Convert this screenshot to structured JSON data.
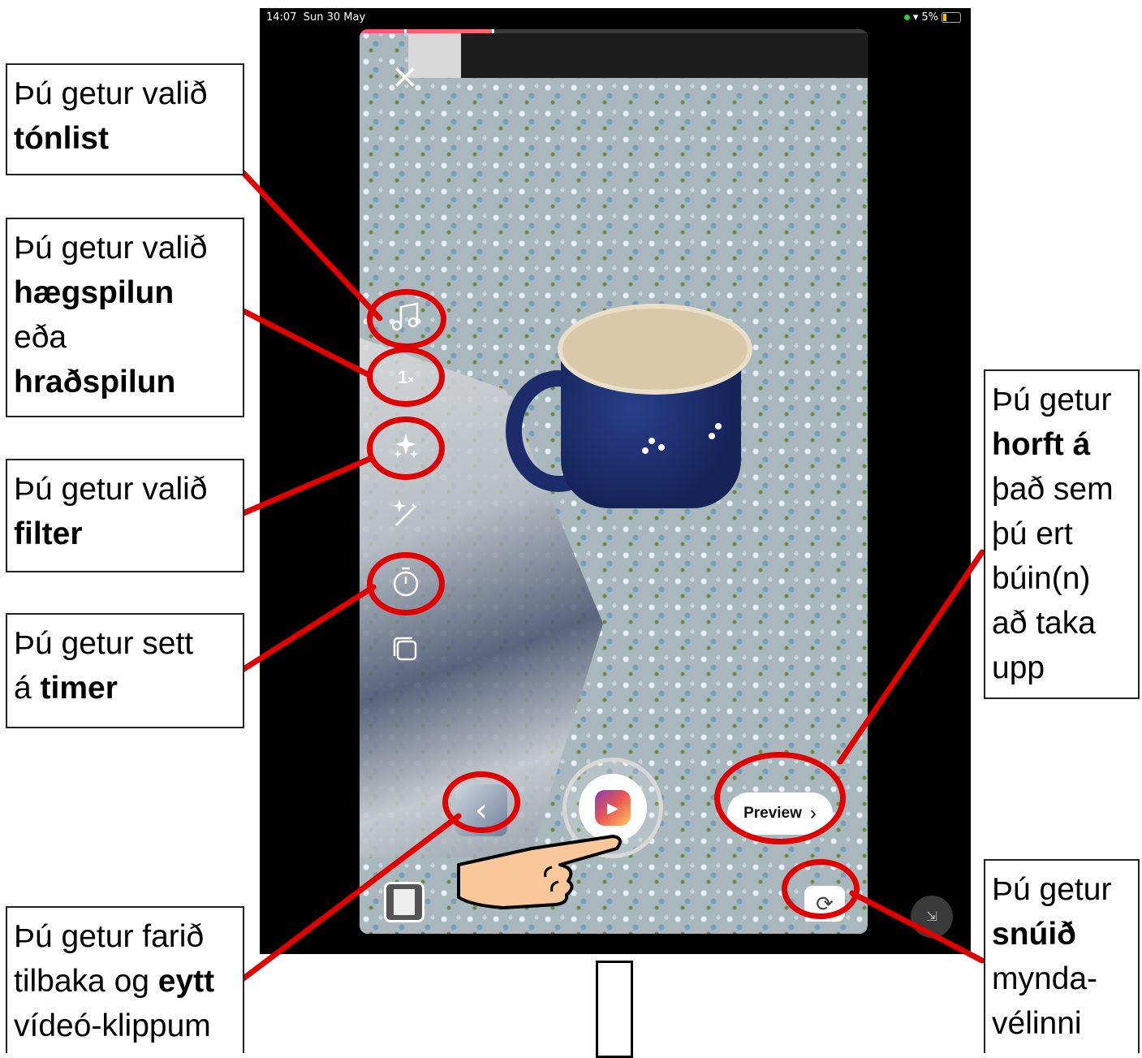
{
  "status_bar": {
    "time": "14:07",
    "date": "Sun 30 May",
    "battery": "5%"
  },
  "camera": {
    "close_icon": "close-icon",
    "side_icons": [
      "music-icon",
      "speed-icon",
      "effects-sparkle-icon",
      "magic-wand-icon",
      "timer-icon",
      "layout-icon"
    ],
    "speed_value": "1",
    "speed_suffix": "×",
    "preview_label": "Preview",
    "preview_chevron": "›",
    "back_chevron": "‹",
    "progress_fraction": 0.26
  },
  "callouts": {
    "music": {
      "line1": "Þú getur valið",
      "bold": "tónlist"
    },
    "speed": {
      "line1": "Þú getur valið",
      "bold1": "hægspilun",
      "line2": "eða",
      "bold2": "hraðspilun"
    },
    "filter": {
      "line1": "Þú getur valið",
      "bold": "filter"
    },
    "timer": {
      "line1": "Þú getur sett",
      "prefix": "á",
      "bold": "timer"
    },
    "back": {
      "line1": "Þú getur farið",
      "line2a": "tilbaka og",
      "bold": "eytt",
      "line3": "vídeó-klippum"
    },
    "preview": {
      "line1": "Þú getur",
      "bold": "horft á",
      "line2": "það sem",
      "line3": "þú ert",
      "line4": "búin(n)",
      "line5": "að taka",
      "line6": "upp"
    },
    "flip": {
      "line1": "Þú getur",
      "bold": "snúið",
      "line2": "mynda-",
      "line3": "vélinni"
    }
  },
  "colors": {
    "highlight": "#e00000",
    "progress": "#ff4f7a"
  }
}
